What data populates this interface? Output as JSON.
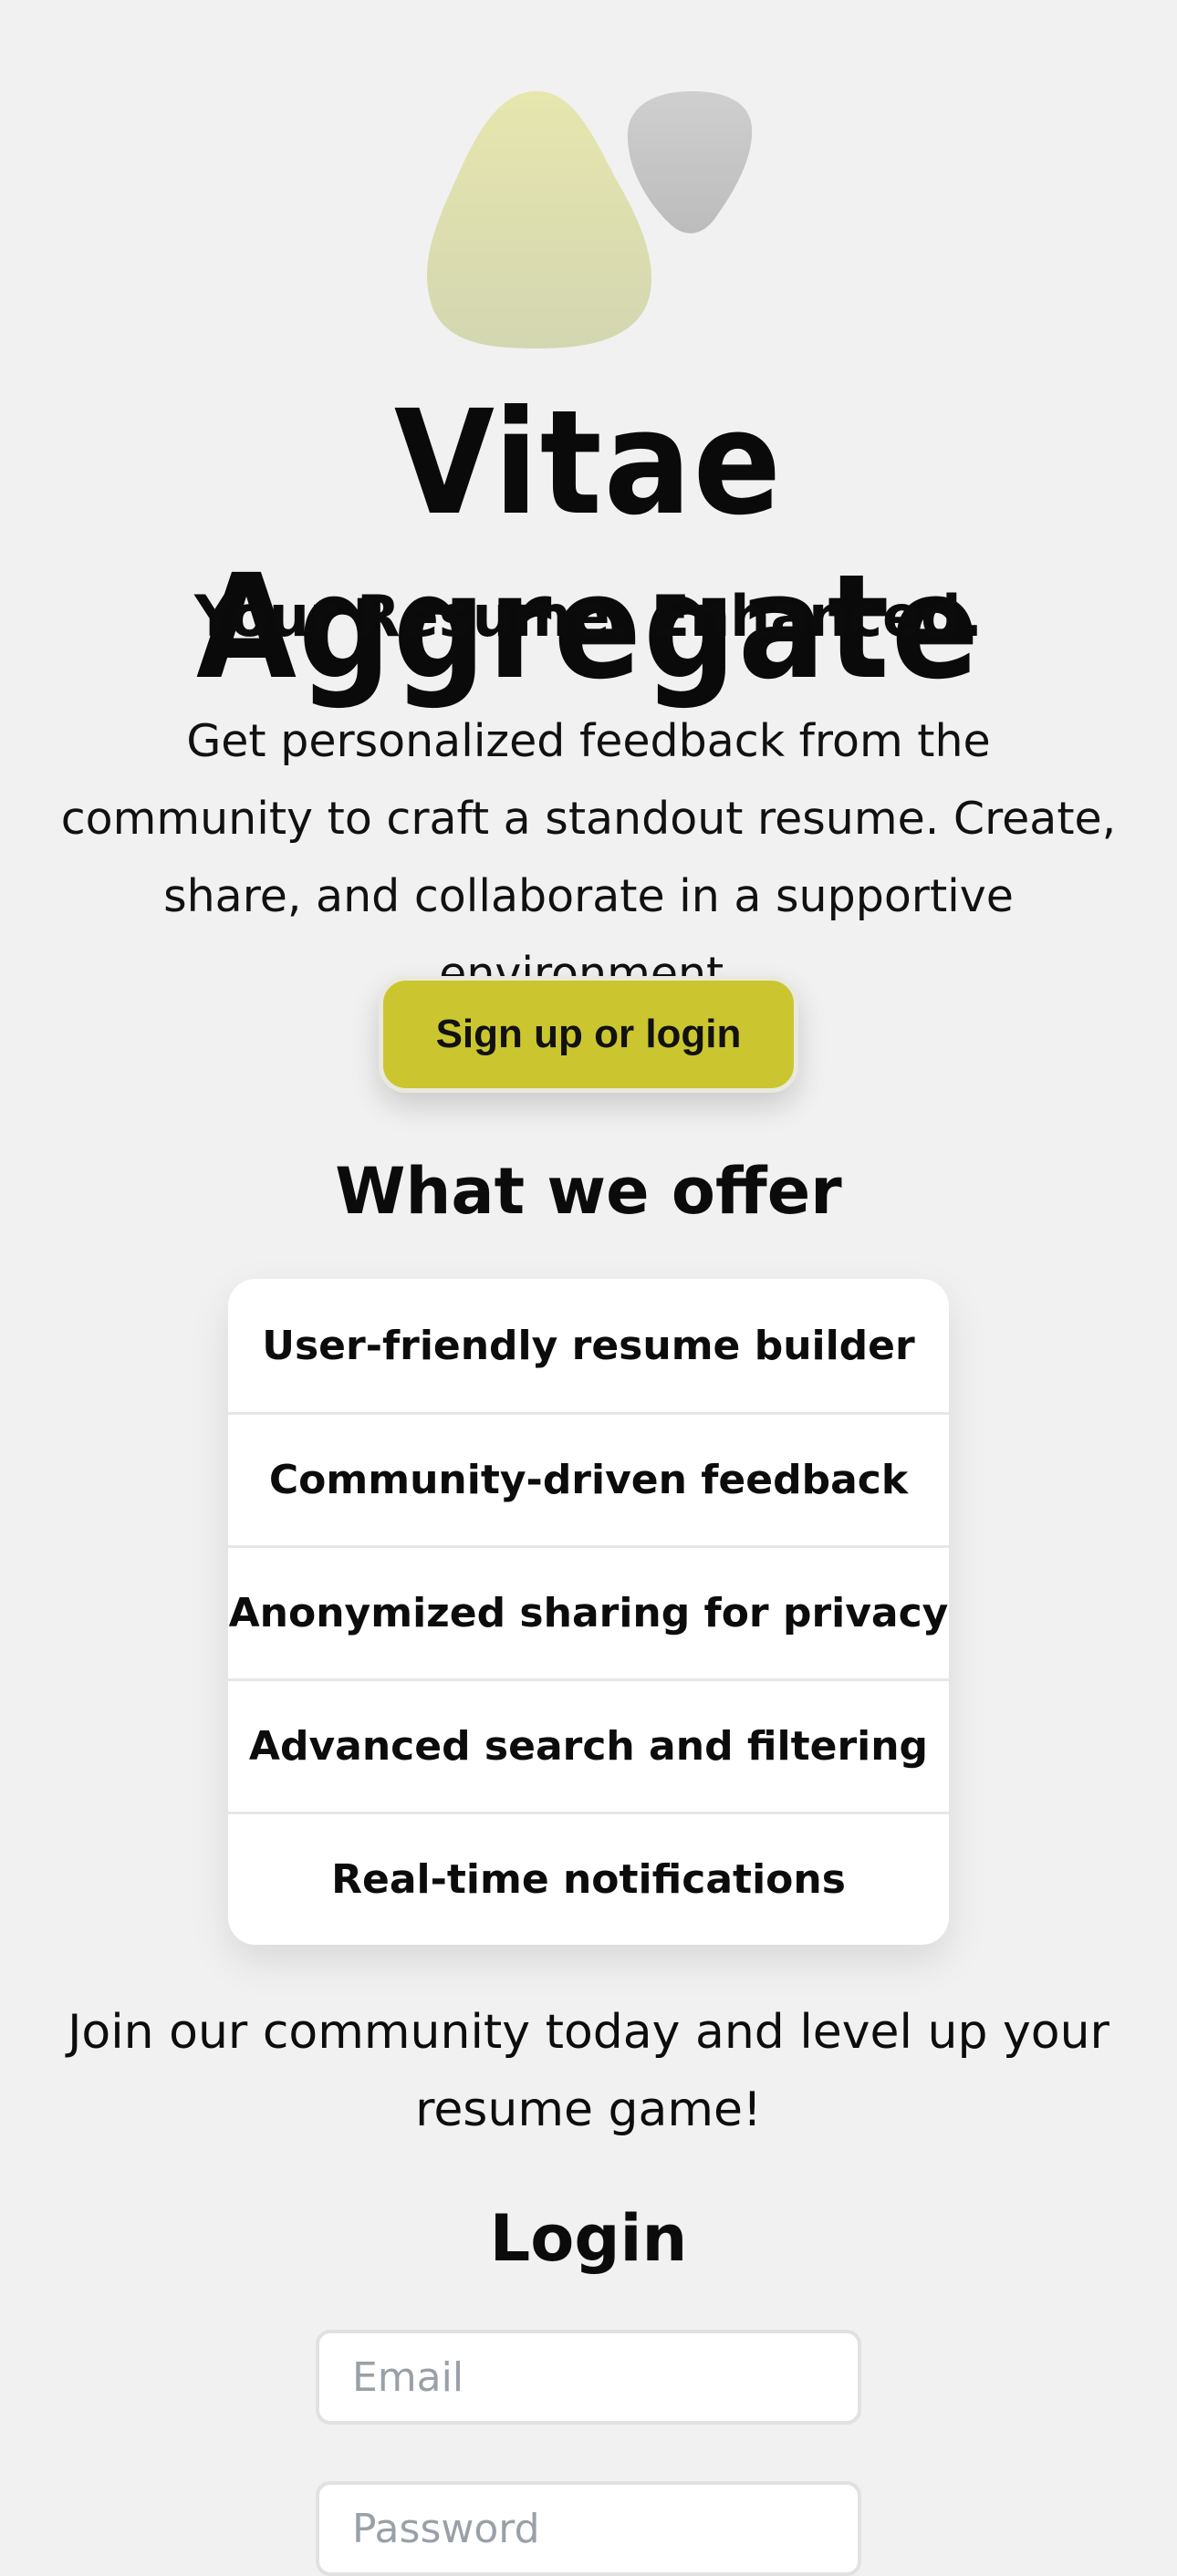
{
  "brand": {
    "title": "Vitae Aggregate",
    "tagline": "Your Resume, Enhanced.",
    "logo_icon": "blob-shapes-logo"
  },
  "intro": {
    "text": "Get personalized feedback from the community to craft a standout resume. Create, share, and collaborate in a supportive environment."
  },
  "cta": {
    "label": "Sign up or login"
  },
  "offer": {
    "heading": "What we offer",
    "items": [
      "User-friendly resume builder",
      "Community-driven feedback",
      "Anonymized sharing for privacy",
      "Advanced search and filtering",
      "Real-time notifications"
    ]
  },
  "join": {
    "text": "Join our community today and level up your resume game!"
  },
  "login": {
    "heading": "Login",
    "email_placeholder": "Email",
    "password_placeholder": "Password"
  },
  "colors": {
    "background": "#f1f1f1",
    "accent": "#cbc62f",
    "card": "#ffffff",
    "logo_large": "#dfe0b0",
    "logo_small": "#c3c3c3"
  }
}
